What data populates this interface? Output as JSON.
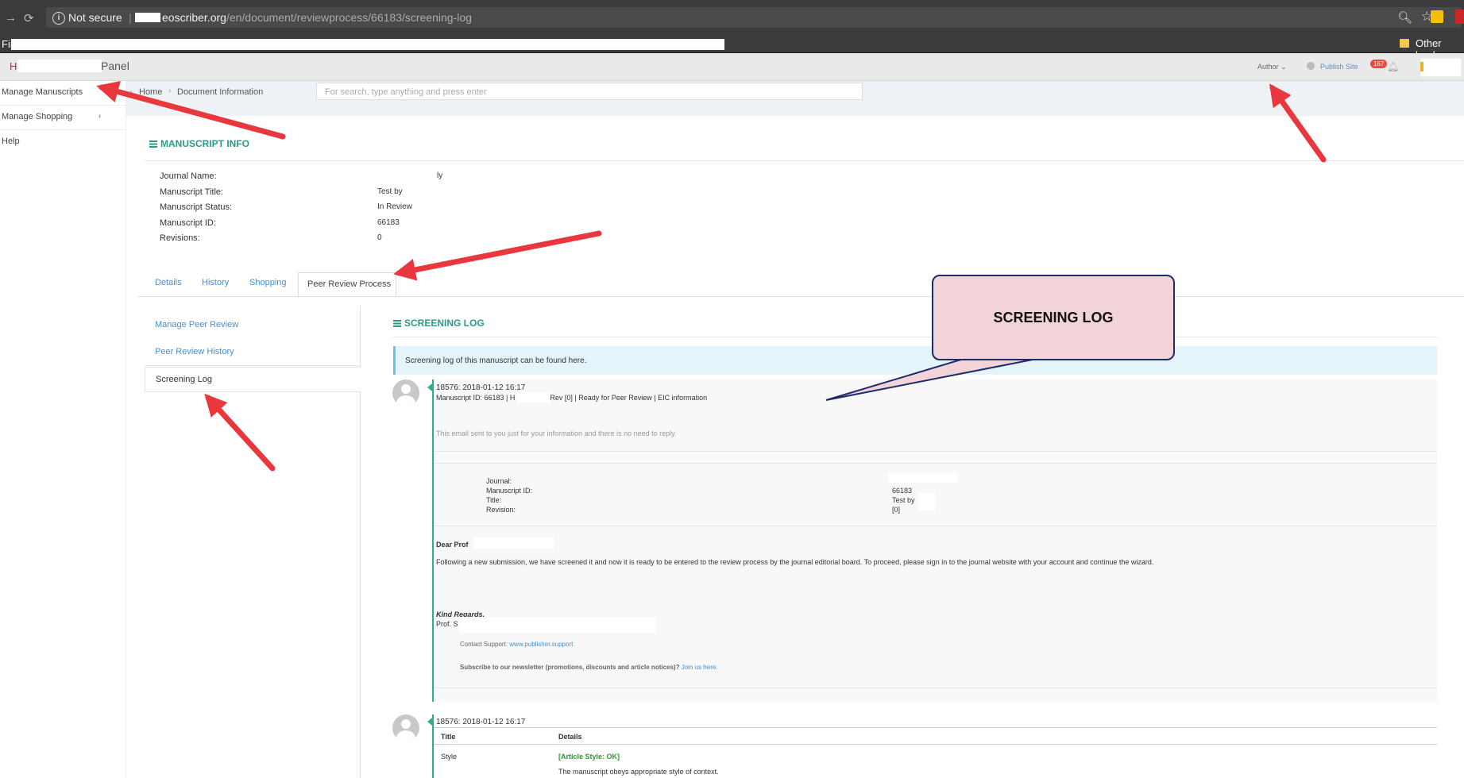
{
  "browser": {
    "not_secure": "Not secure",
    "url_host": "eoscriber.org",
    "url_path": "/en/document/reviewprocess/66183/screening-log",
    "bookmark_fragment": "Fin",
    "other_bookmarks": "Other book"
  },
  "header": {
    "brand_initial": "H",
    "brand_suffix": "Panel",
    "author_label": "Author",
    "publish_label": "Publish Site",
    "notification_count": "167"
  },
  "sidebar": {
    "items": [
      {
        "label": "Manage Manuscripts"
      },
      {
        "label": "Manage Shopping"
      },
      {
        "label": "Help"
      }
    ]
  },
  "breadcrumb": {
    "home": "Home",
    "current": "Document Information"
  },
  "search": {
    "placeholder": "For search, type anything and press enter"
  },
  "manuscript_info": {
    "title": "MANUSCRIPT INFO",
    "fields": [
      {
        "label": "Journal Name:",
        "value": "ly"
      },
      {
        "label": "Manuscript Title:",
        "value": "Test by"
      },
      {
        "label": "Manuscript Status:",
        "value": "In Review"
      },
      {
        "label": "Manuscript ID:",
        "value": "66183"
      },
      {
        "label": "Revisions:",
        "value": "0"
      }
    ]
  },
  "tabs": [
    {
      "label": "Details"
    },
    {
      "label": "History"
    },
    {
      "label": "Shopping"
    },
    {
      "label": "Peer Review Process"
    }
  ],
  "submenu": [
    {
      "label": "Manage Peer Review"
    },
    {
      "label": "Peer Review History"
    },
    {
      "label": "Screening Log"
    }
  ],
  "screening_log": {
    "title": "SCREENING LOG",
    "notice": "Screening log of this manuscript can be found here.",
    "entry1": {
      "header": "18576: 2018-01-12 16:17",
      "subject_start": "Manuscript ID: 66183 | H",
      "subject_end": "n, Rev [0] | Ready for Peer Review | EIC information",
      "info_line": "This email sent to you just for your information and there is no need to reply.",
      "details": [
        {
          "label": "Journal:",
          "value": ""
        },
        {
          "label": "Manuscript ID:",
          "value": "66183"
        },
        {
          "label": "Title:",
          "value": "Test by"
        },
        {
          "label": "Revision:",
          "value": "[0]"
        }
      ],
      "greeting": "Dear Prof",
      "body": "Following a new submission, we have screened it and now it is ready to be entered to the review process by the journal editorial board. To proceed, please sign in to the journal website with your account and continue the wizard.",
      "regards": "Kind Regards,",
      "signature": "Prof. S",
      "contact_label": "Contact Support:",
      "contact_link": "www.publisher.support",
      "subscribe_text": "Subscribe to our newsletter (promotions, discounts and article notices)?",
      "subscribe_link": "Join us here."
    },
    "entry2": {
      "header": "18576: 2018-01-12 16:17",
      "col_title": "Title",
      "col_details": "Details",
      "row_title": "Style",
      "row_status": "[Article Style:  OK]",
      "row_desc": "The manuscript obeys appropriate style of context."
    }
  },
  "annotation": {
    "callout_text": "SCREENING LOG"
  },
  "colors": {
    "accent": "#2c9a8a",
    "timeline": "#2ab08a",
    "link": "#4a8fc9",
    "arrow": "#e8383d",
    "callout_fill": "#f2d4d8",
    "callout_border": "#1e2a6e"
  }
}
